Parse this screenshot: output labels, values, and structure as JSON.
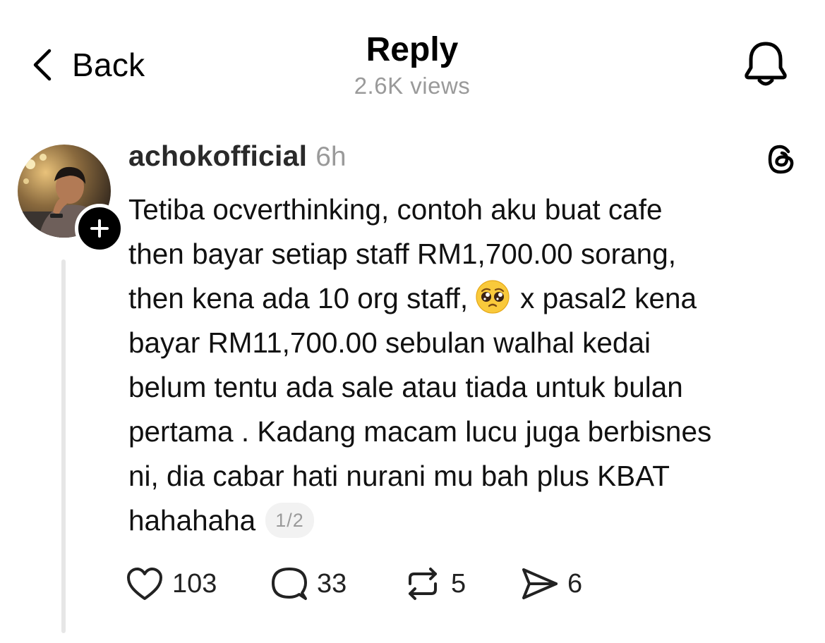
{
  "header": {
    "back_label": "Back",
    "title": "Reply",
    "views": "2.6K views",
    "back_icon": "chevron-left-icon",
    "notification_icon": "bell-icon"
  },
  "post": {
    "username": "achokofficial",
    "timestamp": "6h",
    "body_lines": [
      "Tetiba ocverthinking, contoh aku buat cafe",
      "then bayar setiap staff RM1,700.00 sorang,",
      "then kena ada 10 org staff,",
      "x pasal2 kena",
      "bayar RM11,700.00 sebulan walhal kedai",
      "belum tentu ada sale atau tiada untuk bulan",
      "pertama . Kadang macam lucu juga berbisnes",
      "ni, dia cabar hati nurani mu bah plus KBAT",
      "hahahaha"
    ],
    "emoji": "pleading-face-emoji",
    "page_indicator": "1/2",
    "platform_icon": "threads-logo-icon"
  },
  "actions": {
    "likes": "103",
    "comments": "33",
    "reposts": "5",
    "shares": "6"
  },
  "colors": {
    "text": "#000000",
    "muted": "#9a9a9a",
    "thread_line": "#e6e6e6",
    "pill_bg": "#f2f2f2"
  }
}
